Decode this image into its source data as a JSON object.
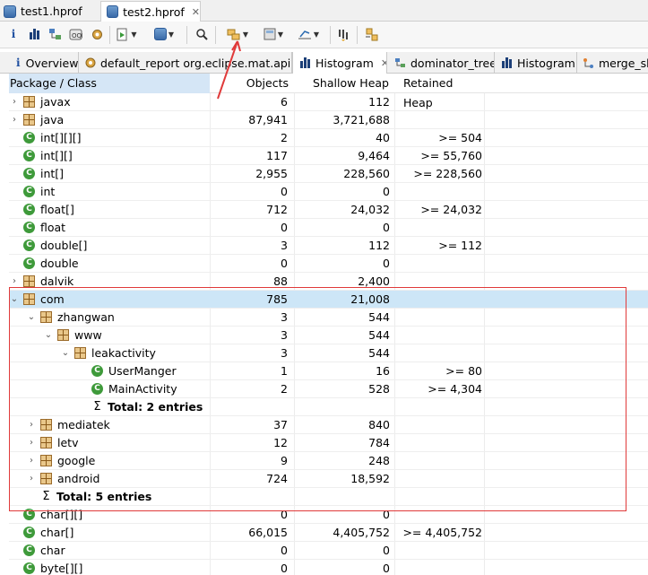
{
  "editor_tabs": [
    {
      "label": "test1.hprof",
      "active": false
    },
    {
      "label": "test2.hprof",
      "active": true
    }
  ],
  "result_tabs": [
    {
      "label": "Overview"
    },
    {
      "label": "default_report  org.eclipse.mat.api..."
    },
    {
      "label": "Histogram",
      "active": true
    },
    {
      "label": "dominator_tree"
    },
    {
      "label": "Histogram"
    },
    {
      "label": "merge_shortest_paths"
    }
  ],
  "columns": {
    "name": "Package / Class",
    "objects": "Objects",
    "shallow": "Shallow Heap",
    "retained": "Retained Heap"
  },
  "rows": [
    {
      "depth": 0,
      "arrow": "›",
      "icon": "pkg",
      "name": "javax",
      "objects": "6",
      "shallow": "112",
      "retained": ""
    },
    {
      "depth": 0,
      "arrow": "›",
      "icon": "pkg",
      "name": "java",
      "objects": "87,941",
      "shallow": "3,721,688",
      "retained": ""
    },
    {
      "depth": 0,
      "arrow": "",
      "icon": "cls",
      "name": "int[][][]",
      "objects": "2",
      "shallow": "40",
      "retained": ">= 504"
    },
    {
      "depth": 0,
      "arrow": "",
      "icon": "cls",
      "name": "int[][]",
      "objects": "117",
      "shallow": "9,464",
      "retained": ">= 55,760"
    },
    {
      "depth": 0,
      "arrow": "",
      "icon": "cls",
      "name": "int[]",
      "objects": "2,955",
      "shallow": "228,560",
      "retained": ">= 228,560"
    },
    {
      "depth": 0,
      "arrow": "",
      "icon": "cls",
      "name": "int",
      "objects": "0",
      "shallow": "0",
      "retained": ""
    },
    {
      "depth": 0,
      "arrow": "",
      "icon": "cls",
      "name": "float[]",
      "objects": "712",
      "shallow": "24,032",
      "retained": ">= 24,032"
    },
    {
      "depth": 0,
      "arrow": "",
      "icon": "cls",
      "name": "float",
      "objects": "0",
      "shallow": "0",
      "retained": ""
    },
    {
      "depth": 0,
      "arrow": "",
      "icon": "cls",
      "name": "double[]",
      "objects": "3",
      "shallow": "112",
      "retained": ">= 112"
    },
    {
      "depth": 0,
      "arrow": "",
      "icon": "cls",
      "name": "double",
      "objects": "0",
      "shallow": "0",
      "retained": ""
    },
    {
      "depth": 0,
      "arrow": "›",
      "icon": "pkg",
      "name": "dalvik",
      "objects": "88",
      "shallow": "2,400",
      "retained": ""
    },
    {
      "depth": 0,
      "arrow": "⌄",
      "icon": "pkg",
      "name": "com",
      "objects": "785",
      "shallow": "21,008",
      "retained": "",
      "selected": true
    },
    {
      "depth": 1,
      "arrow": "⌄",
      "icon": "pkg",
      "name": "zhangwan",
      "objects": "3",
      "shallow": "544",
      "retained": ""
    },
    {
      "depth": 2,
      "arrow": "⌄",
      "icon": "pkg",
      "name": "www",
      "objects": "3",
      "shallow": "544",
      "retained": ""
    },
    {
      "depth": 3,
      "arrow": "⌄",
      "icon": "pkg",
      "name": "leakactivity",
      "objects": "3",
      "shallow": "544",
      "retained": ""
    },
    {
      "depth": 4,
      "arrow": "",
      "icon": "cls",
      "name": "UserManger",
      "objects": "1",
      "shallow": "16",
      "retained": ">= 80"
    },
    {
      "depth": 4,
      "arrow": "",
      "icon": "cls",
      "name": "MainActivity",
      "objects": "2",
      "shallow": "528",
      "retained": ">= 4,304"
    },
    {
      "depth": 4,
      "arrow": "",
      "icon": "sigma",
      "name": "Total: 2 entries",
      "objects": "",
      "shallow": "",
      "retained": "",
      "bold": true
    },
    {
      "depth": 1,
      "arrow": "›",
      "icon": "pkg",
      "name": "mediatek",
      "objects": "37",
      "shallow": "840",
      "retained": ""
    },
    {
      "depth": 1,
      "arrow": "›",
      "icon": "pkg",
      "name": "letv",
      "objects": "12",
      "shallow": "784",
      "retained": ""
    },
    {
      "depth": 1,
      "arrow": "›",
      "icon": "pkg",
      "name": "google",
      "objects": "9",
      "shallow": "248",
      "retained": ""
    },
    {
      "depth": 1,
      "arrow": "›",
      "icon": "pkg",
      "name": "android",
      "objects": "724",
      "shallow": "18,592",
      "retained": ""
    },
    {
      "depth": 1,
      "arrow": "",
      "icon": "sigma",
      "name": "Total: 5 entries",
      "objects": "",
      "shallow": "",
      "retained": "",
      "bold": true
    },
    {
      "depth": 0,
      "arrow": "",
      "icon": "cls",
      "name": "char[][]",
      "objects": "0",
      "shallow": "0",
      "retained": ""
    },
    {
      "depth": 0,
      "arrow": "",
      "icon": "cls",
      "name": "char[]",
      "objects": "66,015",
      "shallow": "4,405,752",
      "retained": ">= 4,405,752"
    },
    {
      "depth": 0,
      "arrow": "",
      "icon": "cls",
      "name": "char",
      "objects": "0",
      "shallow": "0",
      "retained": ""
    },
    {
      "depth": 0,
      "arrow": "",
      "icon": "cls",
      "name": "byte[][]",
      "objects": "0",
      "shallow": "0",
      "retained": ""
    }
  ]
}
